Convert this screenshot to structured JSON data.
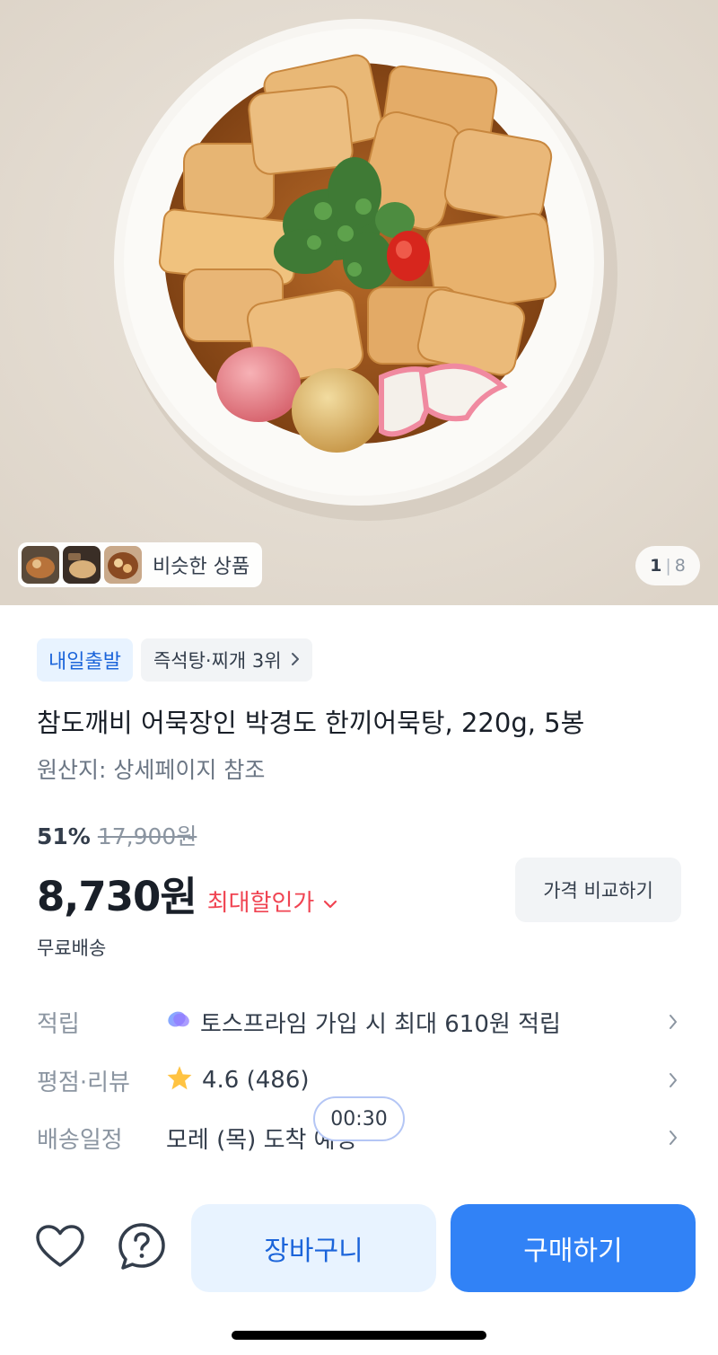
{
  "hero": {
    "image_icon": "fish-cake-soup-photo",
    "similar_products_label": "비슷한 상품",
    "page_current": "1",
    "page_total": "8"
  },
  "badges": {
    "departure": "내일출발",
    "ranking": "즉석탕·찌개 3위"
  },
  "product": {
    "title": "참도깨비 어묵장인 박경도 한끼어묵탕, 220g, 5봉",
    "origin": "원산지: 상세페이지 참조"
  },
  "pricing": {
    "discount_rate": "51%",
    "original_price": "17,900원",
    "price": "8,730원",
    "max_discount_label": "최대할인가",
    "compare_button": "가격 비교하기",
    "shipping": "무료배송"
  },
  "info": {
    "points_label": "적립",
    "points_value": "토스프라임 가입 시 최대 610원 적립",
    "rating_label": "평점·리뷰",
    "rating_value": "4.6 (486)",
    "delivery_label": "배송일정",
    "delivery_value": "모레 (목) 도착 예정"
  },
  "timer": "00:30",
  "bottom_bar": {
    "cart_button": "장바구니",
    "buy_button": "구매하기"
  },
  "colors": {
    "accent": "#3182f6",
    "sale_red": "#f04452",
    "star": "#ffc342"
  }
}
